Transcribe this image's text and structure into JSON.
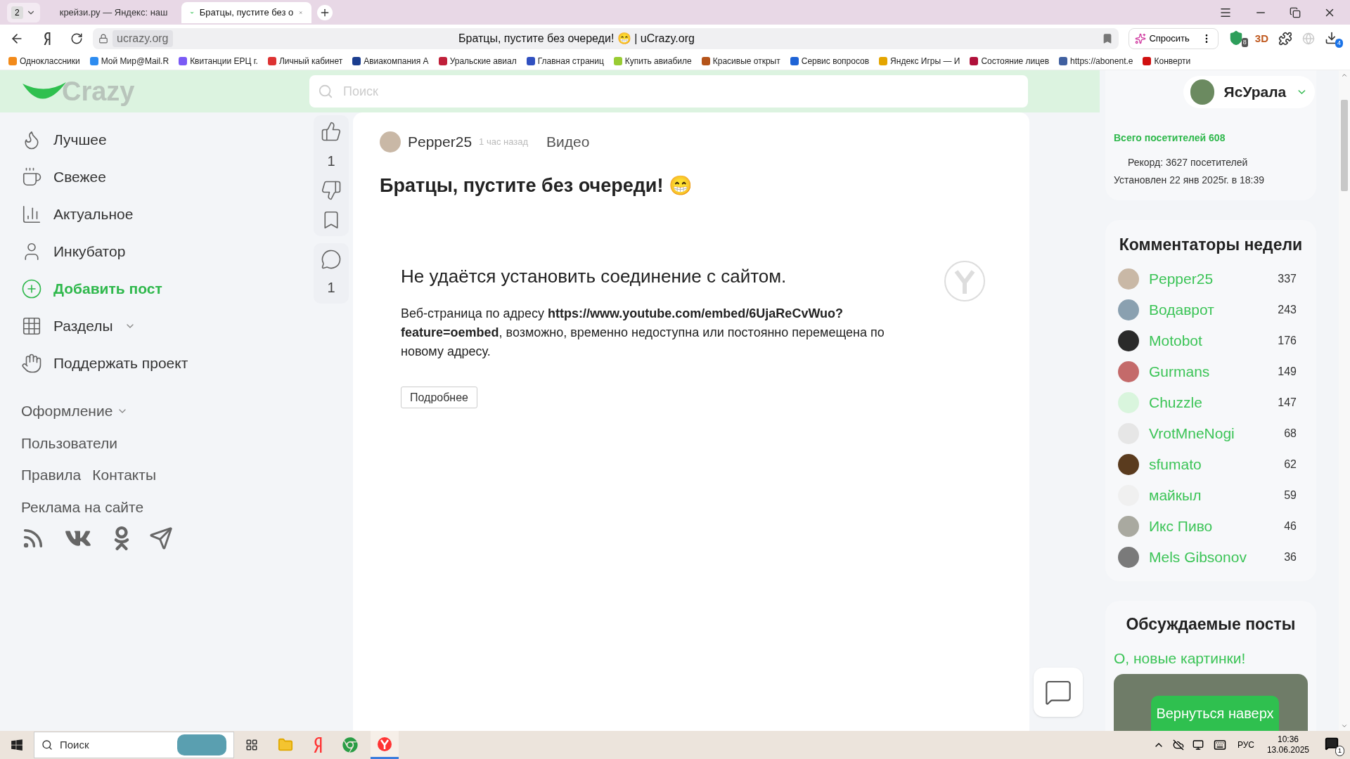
{
  "browser": {
    "tab_count": "2",
    "tabs": [
      {
        "title": "крейзи.ру — Яндекс: наш",
        "selected": false
      },
      {
        "title": "Братцы, пустите без о",
        "selected": true
      }
    ],
    "address": "ucrazy.org",
    "page_title": "Братцы, пустите без очереди! 😁 | uCrazy.org",
    "ask_button": "Спросить",
    "toolbar_badges": {
      "protect": "8",
      "downloads": "4"
    },
    "badge_3d": "3D",
    "bookmarks": [
      "Одноклассники",
      "Мой Мир@Mail.R",
      "Квитанции ЕРЦ г.",
      "Личный кабинет",
      "Авиакомпания А",
      "Уральские авиал",
      "Главная страниц",
      "Купить авиабиле",
      "Красивые открыт",
      "Сервис вопросов",
      "Яндекс Игры — И",
      "Состояние лицев",
      "https://abonent.e",
      "Конверти"
    ]
  },
  "header": {
    "logo": "Crazy",
    "search": {
      "placeholder": "Поиск"
    },
    "user": "ЯсУрала"
  },
  "sidebar": {
    "items": [
      {
        "label": "Лучшее",
        "kind": "nav"
      },
      {
        "label": "Свежее",
        "kind": "nav"
      },
      {
        "label": "Актуальное",
        "kind": "nav"
      },
      {
        "label": "Инкубатор",
        "kind": "nav"
      },
      {
        "label": "Добавить пост",
        "kind": "add"
      },
      {
        "label": "Разделы",
        "kind": "menu"
      },
      {
        "label": "Поддержать проект",
        "kind": "nav"
      }
    ],
    "links": [
      [
        {
          "label": "Оформление",
          "kind": "menu"
        }
      ],
      [
        {
          "label": "Пользователи",
          "kind": "nav"
        }
      ],
      [
        {
          "label": "Правила",
          "kind": "nav"
        },
        {
          "label": "Контакты",
          "kind": "nav"
        }
      ],
      [
        {
          "label": "Реклама на сайте",
          "kind": "nav"
        }
      ]
    ]
  },
  "post": {
    "likes": "1",
    "comments": "1",
    "author": "Pepper25",
    "time": "1 час назад",
    "category": "Видео",
    "title": "Братцы, пустите без очереди! 😁",
    "error": {
      "heading": "Не удаётся установить соединение с сайтом.",
      "message": "Веб-страница по адресу **https://www.youtube.com/embed/6UjaReCvWuo?feature=oembed**, возможно, временно недоступна или постоянно перемещена по новому адресу.",
      "button": "Подробнее"
    }
  },
  "stats": {
    "total": "Всего посетителей 608",
    "record": "Рекорд: 3627 посетителей",
    "record_date": "Установлен 22 янв 2025г. в 18:39"
  },
  "commentators": {
    "title": "Комментаторы недели",
    "rows": [
      {
        "name": "Pepper25",
        "count": "337"
      },
      {
        "name": "Водаврот",
        "count": "243"
      },
      {
        "name": "Motobot",
        "count": "176"
      },
      {
        "name": "Gurmans",
        "count": "149"
      },
      {
        "name": "Chuzzle",
        "count": "147"
      },
      {
        "name": "VrotMneNogi",
        "count": "68"
      },
      {
        "name": "sfumato",
        "count": "62"
      },
      {
        "name": "майкыл",
        "count": "59"
      },
      {
        "name": "Икс Пиво",
        "count": "46"
      },
      {
        "name": "Mels Gibsonov",
        "count": "36"
      }
    ]
  },
  "discussed": {
    "title": "Обсуждаемые посты",
    "post": "О, новые картинки!"
  },
  "back_to_top": "Вернуться наверх",
  "taskbar": {
    "search": "Поиск",
    "language": "РУС",
    "time": "10:36",
    "date": "13.06.2025",
    "notifications": "1"
  }
}
